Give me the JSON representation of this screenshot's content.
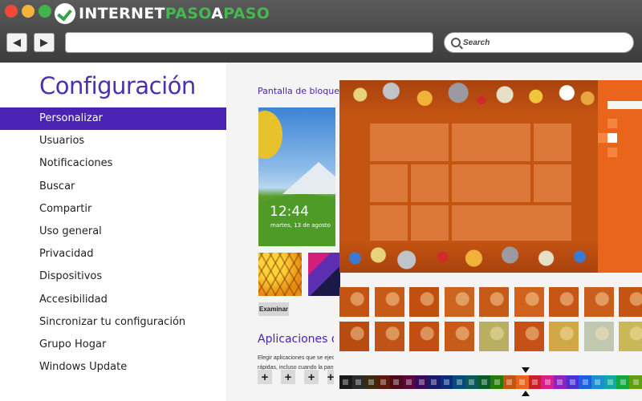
{
  "browser": {
    "logo_prefix": "INTERNET",
    "logo_accent": "PASO",
    "logo_mid": "A",
    "logo_suffix": "PASO",
    "back_icon": "◀",
    "forward_icon": "▶",
    "search_placeholder": "Search",
    "colors": {
      "chrome": "#4a4a4a",
      "logo_green": "#46b84f"
    }
  },
  "settings": {
    "title": "Configuración",
    "menu": [
      {
        "label": "Personalizar",
        "active": true
      },
      {
        "label": "Usuarios"
      },
      {
        "label": "Notificaciones"
      },
      {
        "label": "Buscar"
      },
      {
        "label": "Compartir"
      },
      {
        "label": "Uso general"
      },
      {
        "label": "Privacidad"
      },
      {
        "label": "Dispositivos"
      },
      {
        "label": "Accesibilidad"
      },
      {
        "label": "Sincronizar tu configuración"
      },
      {
        "label": "Grupo Hogar"
      },
      {
        "label": "Windows Update"
      }
    ],
    "accent_color": "#4a22b4"
  },
  "lock_screen": {
    "section_title": "Pantalla de bloqueo",
    "time": "12:44",
    "date": "martes, 13 de agosto",
    "browse_label": "Examinar",
    "apps_title": "Aplicaciones de pantalla de bloqueo",
    "apps_description_1": "Elegir aplicaciones que se ejecuten",
    "apps_description_2": "rápidas, incluso cuando la pantalla",
    "add_icon": "+"
  },
  "start_screen": {
    "background_color": "#c45412",
    "panel_color": "#e8651b"
  },
  "background_swatches": [
    "#c45412",
    "#c85a18",
    "#c14f10",
    "#cc6420",
    "#c85a18",
    "#d0621e",
    "#c65516",
    "#cb5e1c",
    "#c45412",
    "#b84c10",
    "#c05416",
    "#c24e12",
    "#c85a1a",
    "#b8b060",
    "#c65016",
    "#d0a848",
    "#c0c8b0",
    "#c8b858"
  ],
  "color_options": [
    "#1a1a1a",
    "#2b2b2b",
    "#3a2a10",
    "#5a1a08",
    "#4a0a1a",
    "#5a0a3a",
    "#3a0a5a",
    "#1a1a6a",
    "#0a2a7a",
    "#0a4a7a",
    "#0a5a5a",
    "#0a5a2a",
    "#2a7a0a",
    "#c45412",
    "#e8651b",
    "#c8202a",
    "#d8208a",
    "#9020c0",
    "#4a30d0",
    "#1a60e0",
    "#1a90d0",
    "#10a8a0",
    "#10a840",
    "#60a010"
  ]
}
